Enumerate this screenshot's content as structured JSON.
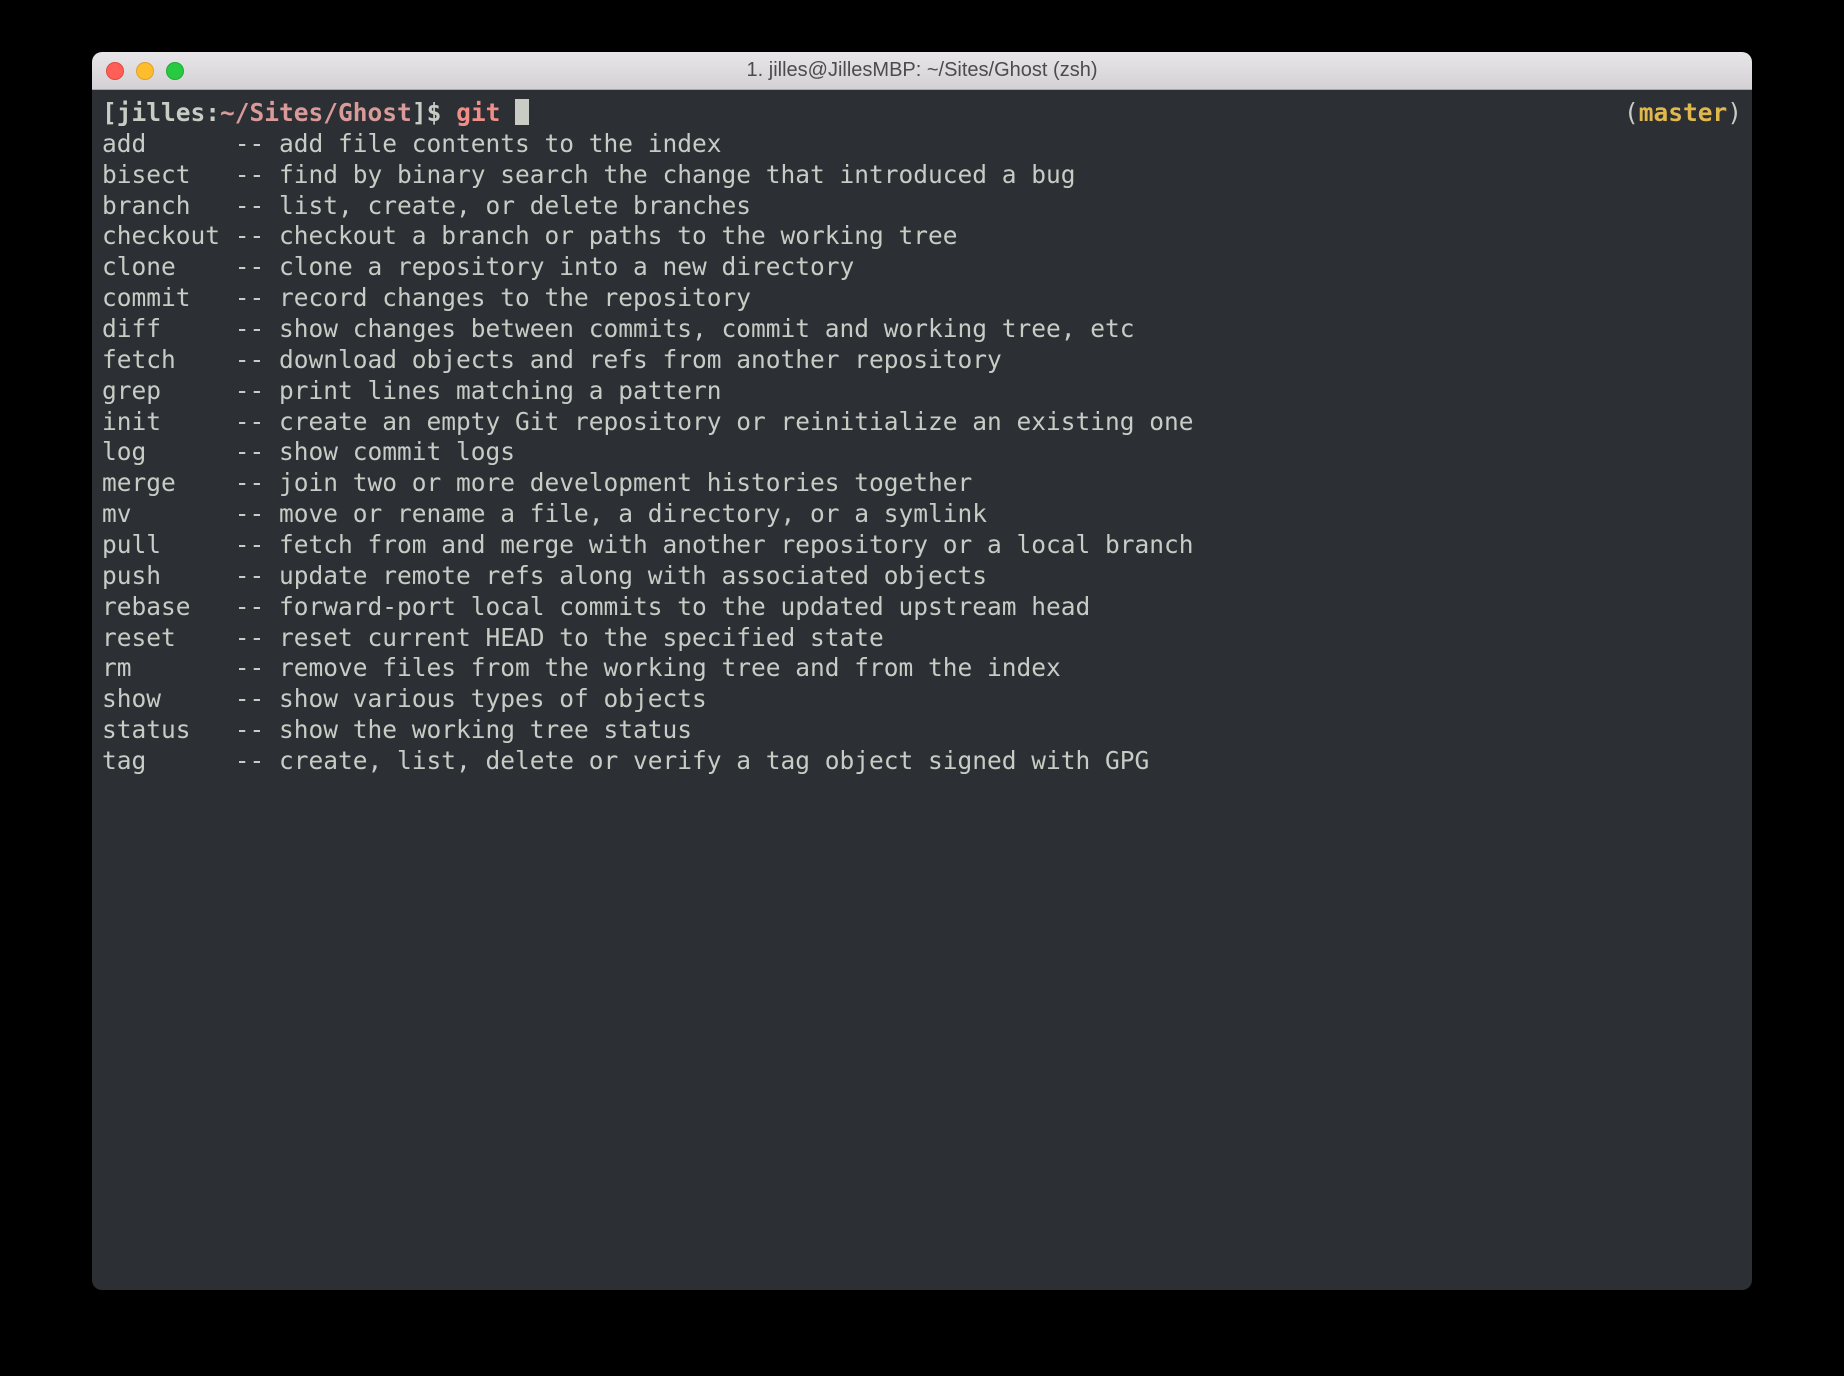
{
  "window": {
    "title": "1. jilles@JillesMBP: ~/Sites/Ghost (zsh)"
  },
  "prompt": {
    "open_bracket": "[",
    "user": "jilles",
    "colon": ":",
    "path": "~/Sites/Ghost",
    "close_bracket": "]",
    "dollar": "$ ",
    "command": "git ",
    "branch_open": "(",
    "branch": "master",
    "branch_close": ")"
  },
  "completions": [
    {
      "cmd": "add",
      "desc": "add file contents to the index"
    },
    {
      "cmd": "bisect",
      "desc": "find by binary search the change that introduced a bug"
    },
    {
      "cmd": "branch",
      "desc": "list, create, or delete branches"
    },
    {
      "cmd": "checkout",
      "desc": "checkout a branch or paths to the working tree"
    },
    {
      "cmd": "clone",
      "desc": "clone a repository into a new directory"
    },
    {
      "cmd": "commit",
      "desc": "record changes to the repository"
    },
    {
      "cmd": "diff",
      "desc": "show changes between commits, commit and working tree, etc"
    },
    {
      "cmd": "fetch",
      "desc": "download objects and refs from another repository"
    },
    {
      "cmd": "grep",
      "desc": "print lines matching a pattern"
    },
    {
      "cmd": "init",
      "desc": "create an empty Git repository or reinitialize an existing one"
    },
    {
      "cmd": "log",
      "desc": "show commit logs"
    },
    {
      "cmd": "merge",
      "desc": "join two or more development histories together"
    },
    {
      "cmd": "mv",
      "desc": "move or rename a file, a directory, or a symlink"
    },
    {
      "cmd": "pull",
      "desc": "fetch from and merge with another repository or a local branch"
    },
    {
      "cmd": "push",
      "desc": "update remote refs along with associated objects"
    },
    {
      "cmd": "rebase",
      "desc": "forward-port local commits to the updated upstream head"
    },
    {
      "cmd": "reset",
      "desc": "reset current HEAD to the specified state"
    },
    {
      "cmd": "rm",
      "desc": "remove files from the working tree and from the index"
    },
    {
      "cmd": "show",
      "desc": "show various types of objects"
    },
    {
      "cmd": "status",
      "desc": "show the working tree status"
    },
    {
      "cmd": "tag",
      "desc": "create, list, delete or verify a tag object signed with GPG"
    }
  ],
  "layout": {
    "cmd_col_width": 9,
    "separator": "-- "
  }
}
